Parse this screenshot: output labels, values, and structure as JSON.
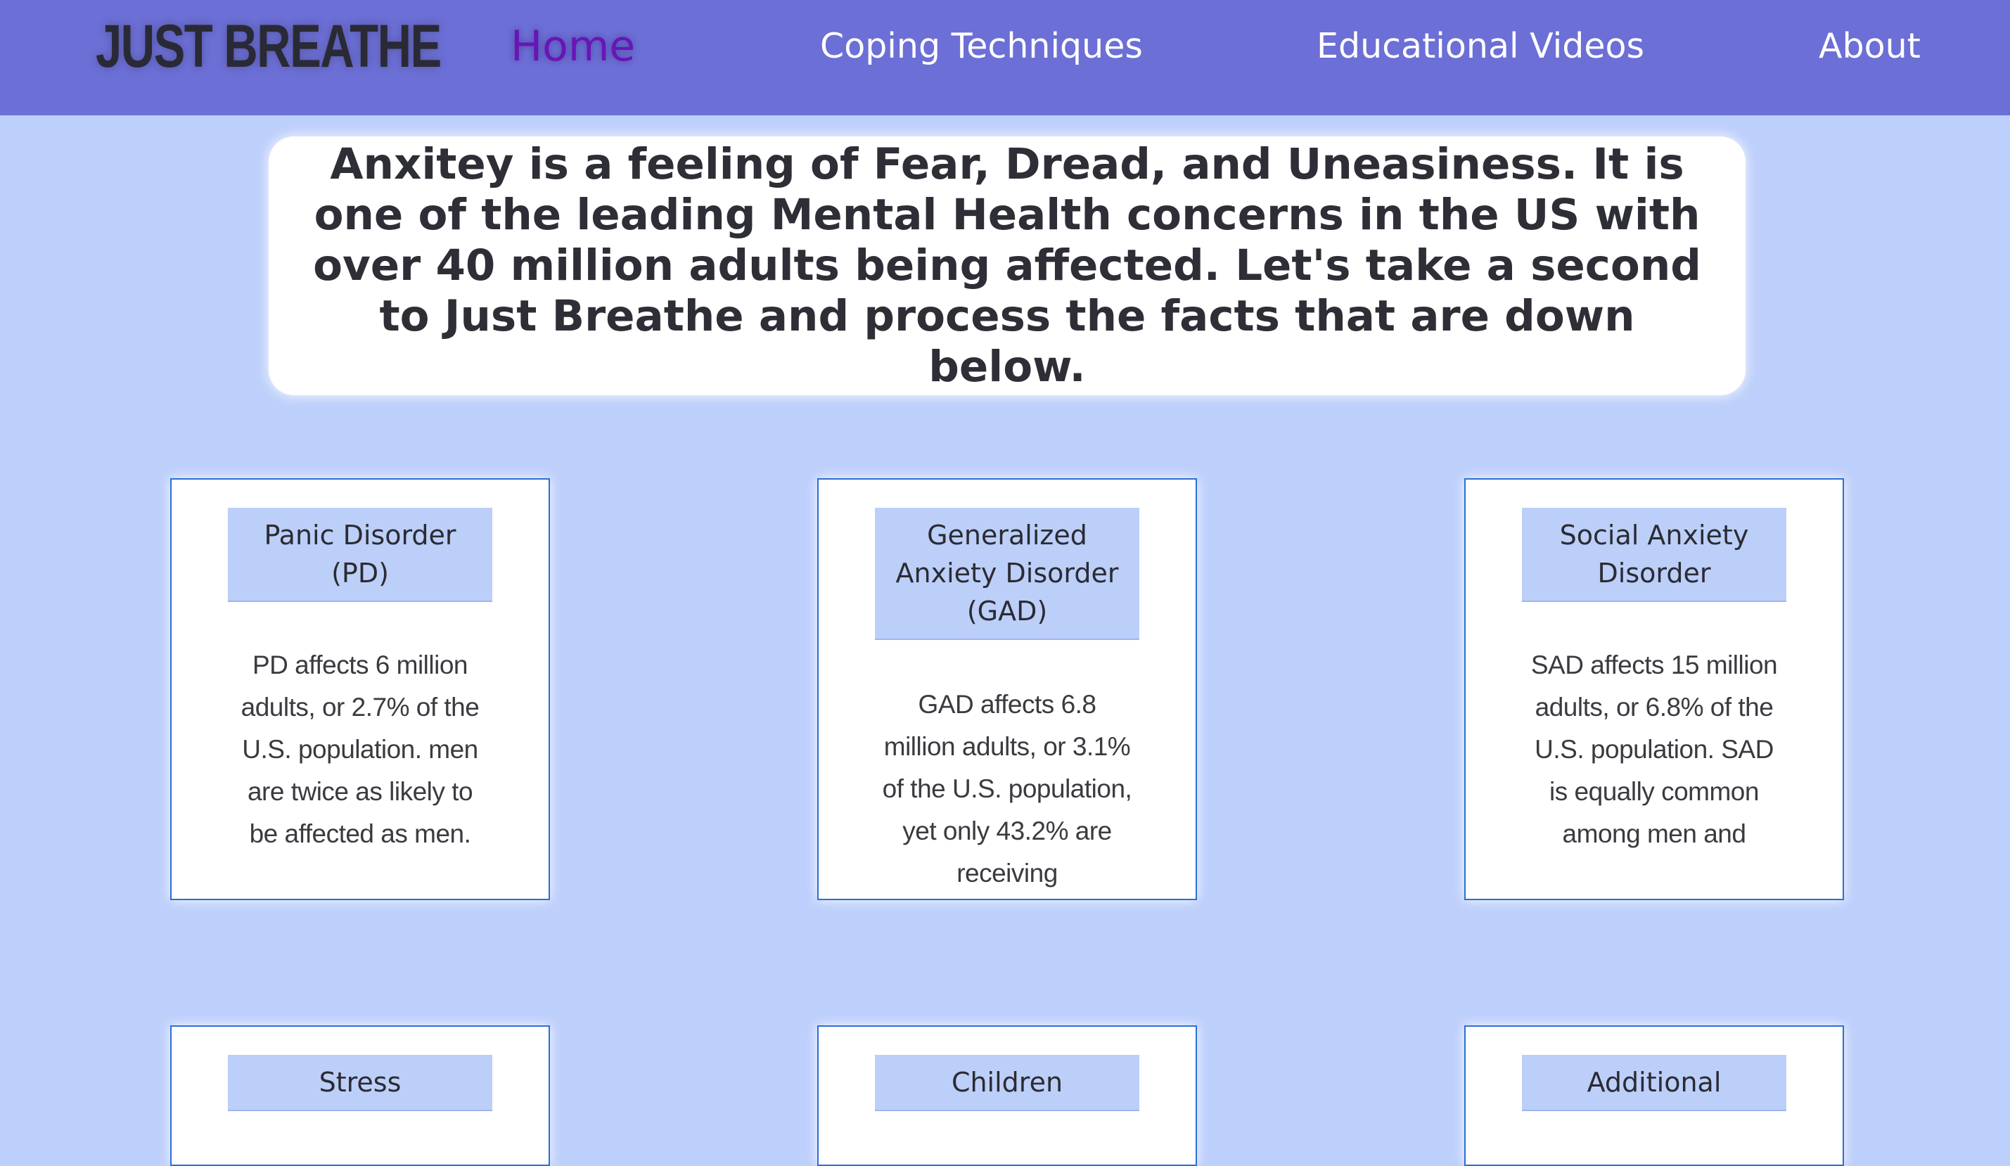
{
  "site": {
    "logo": "JUST BREATHE"
  },
  "nav": {
    "home": "Home",
    "coping": "Coping Techniques",
    "videos": "Educational Videos",
    "about": "About"
  },
  "intro": {
    "text": "Anxitey is a feeling of Fear, Dread, and Uneasiness. It is one of the leading Mental Health concerns in the US with over 40 million adults being affected. Let's take a second to Just Breathe and process the facts that are down below."
  },
  "cards": [
    {
      "title": "Panic Disorder (PD)",
      "body": "PD affects 6 million adults, or 2.7% of the U.S. population. men are twice as likely to be affected as men."
    },
    {
      "title": "Generalized Anxiety Disorder (GAD)",
      "body": "GAD affects 6.8 million adults, or 3.1% of the U.S. population, yet only 43.2% are receiving"
    },
    {
      "title": "Social Anxiety Disorder",
      "body": "SAD affects 15 million adults, or 6.8% of the U.S. population. SAD is equally common among men and"
    },
    {
      "title": "Stress",
      "body": ""
    },
    {
      "title": "Children",
      "body": ""
    },
    {
      "title": "Additional",
      "body": ""
    }
  ],
  "colors": {
    "navbar": "#6c6fd6",
    "page_background": "#bdcffb",
    "active_nav": "#6a14b8",
    "card_border": "#2b6fd4",
    "card_title_background": "#bccff9"
  }
}
